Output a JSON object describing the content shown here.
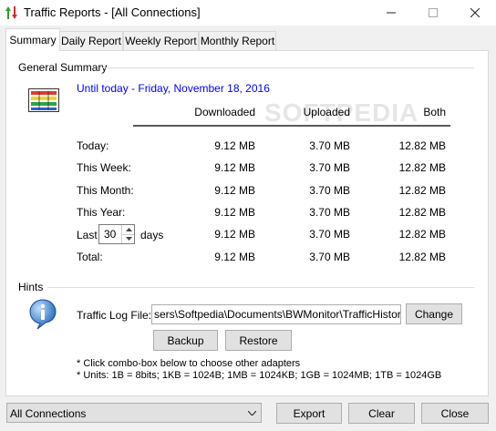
{
  "window": {
    "title": "Traffic Reports - [All Connections]"
  },
  "tabs": [
    "Summary",
    "Daily Report",
    "Weekly Report",
    "Monthly Report"
  ],
  "summary": {
    "group_title": "General Summary",
    "date_heading": "Until today - Friday, November 18, 2016",
    "columns": [
      "Downloaded",
      "Uploaded",
      "Both"
    ],
    "rows": [
      {
        "label": "Today:",
        "downloaded": "9.12 MB",
        "uploaded": "3.70 MB",
        "both": "12.82 MB"
      },
      {
        "label": "This Week:",
        "downloaded": "9.12 MB",
        "uploaded": "3.70 MB",
        "both": "12.82 MB"
      },
      {
        "label": "This Month:",
        "downloaded": "9.12 MB",
        "uploaded": "3.70 MB",
        "both": "12.82 MB"
      },
      {
        "label": "This Year:",
        "downloaded": "9.12 MB",
        "uploaded": "3.70 MB",
        "both": "12.82 MB"
      },
      {
        "label": "Last",
        "downloaded": "9.12 MB",
        "uploaded": "3.70 MB",
        "both": "12.82 MB"
      },
      {
        "label": "Total:",
        "downloaded": "9.12 MB",
        "uploaded": "3.70 MB",
        "both": "12.82 MB"
      }
    ],
    "last_days_value": "30",
    "last_days_suffix": "days",
    "watermark": "SOFTPEDIA"
  },
  "hints": {
    "group_title": "Hints",
    "log_file_label": "Traffic Log File:",
    "log_file_value": "sers\\Softpedia\\Documents\\BWMonitor\\TrafficHistory.log",
    "change_label": "Change",
    "backup_label": "Backup",
    "restore_label": "Restore",
    "note1": "* Click combo-box below to choose other adapters",
    "note2": "* Units: 1B = 8bits; 1KB = 1024B; 1MB = 1024KB; 1GB = 1024MB; 1TB = 1024GB"
  },
  "footer": {
    "adapter_selected": "All Connections",
    "export_label": "Export",
    "clear_label": "Clear",
    "close_label": "Close"
  },
  "colors": {
    "accent_link": "#0000ff",
    "button_face": "#e1e1e1"
  }
}
